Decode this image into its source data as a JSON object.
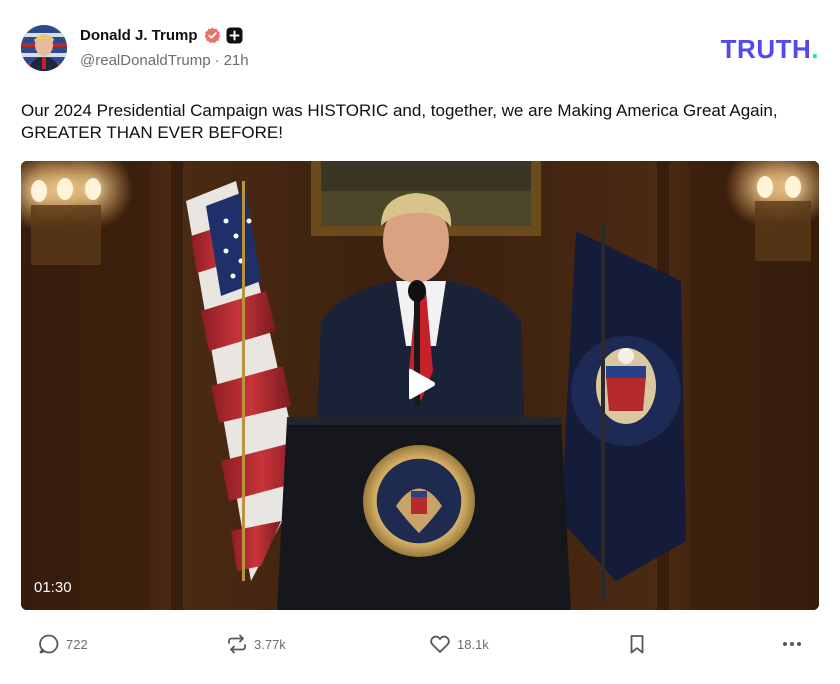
{
  "author": {
    "display_name": "Donald J. Trump",
    "handle": "@realDonaldTrump",
    "separator": "·",
    "time_ago": "21h",
    "verified_icon": "verified-badge-icon",
    "plus_icon": "plus-badge-icon"
  },
  "brand": {
    "name": "TRUTH",
    "dot": ".",
    "color": "#5448ee",
    "dot_color": "#17e0c6"
  },
  "post": {
    "text": "Our 2024 Presidential Campaign was HISTORIC and, together, we are Making America Great Again, GREATER THAN EVER BEFORE!"
  },
  "video": {
    "duration": "01:30",
    "play_icon": "play-icon"
  },
  "actions": {
    "replies": "722",
    "retruths": "3.77k",
    "likes": "18.1k",
    "icons": [
      "reply-icon",
      "retruth-icon",
      "heart-icon",
      "bookmark-icon",
      "more-icon"
    ]
  }
}
